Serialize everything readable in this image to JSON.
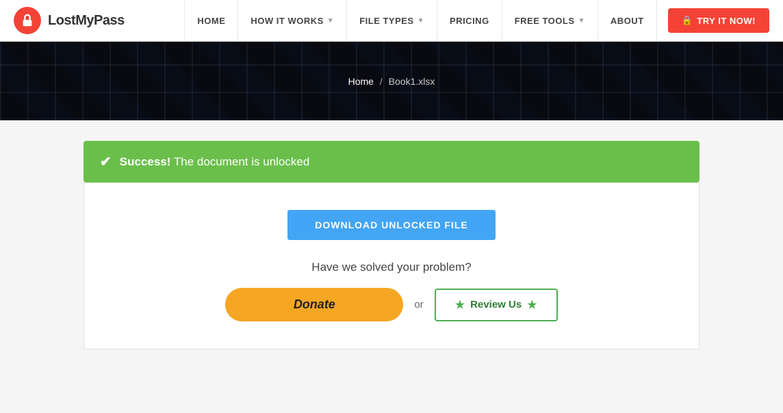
{
  "brand": {
    "name": "LostMyPass"
  },
  "navbar": {
    "items": [
      {
        "label": "HOME",
        "hasDropdown": false
      },
      {
        "label": "HOW IT WORKS",
        "hasDropdown": true
      },
      {
        "label": "FILE TYPES",
        "hasDropdown": true
      },
      {
        "label": "PRICING",
        "hasDropdown": false
      },
      {
        "label": "FREE TOOLS",
        "hasDropdown": true
      },
      {
        "label": "ABOUT",
        "hasDropdown": false
      }
    ],
    "cta_label": "TRY IT NOW!",
    "cta_icon": "lock-icon"
  },
  "hero": {
    "breadcrumb_home": "Home",
    "breadcrumb_file": "Book1.xlsx"
  },
  "success": {
    "bold_text": "Success!",
    "message": " The document is unlocked"
  },
  "content": {
    "download_label": "DOWNLOAD UNLOCKED FILE",
    "question": "Have we solved your problem?",
    "donate_label": "Donate",
    "or_text": "or",
    "review_label": "Review Us"
  }
}
